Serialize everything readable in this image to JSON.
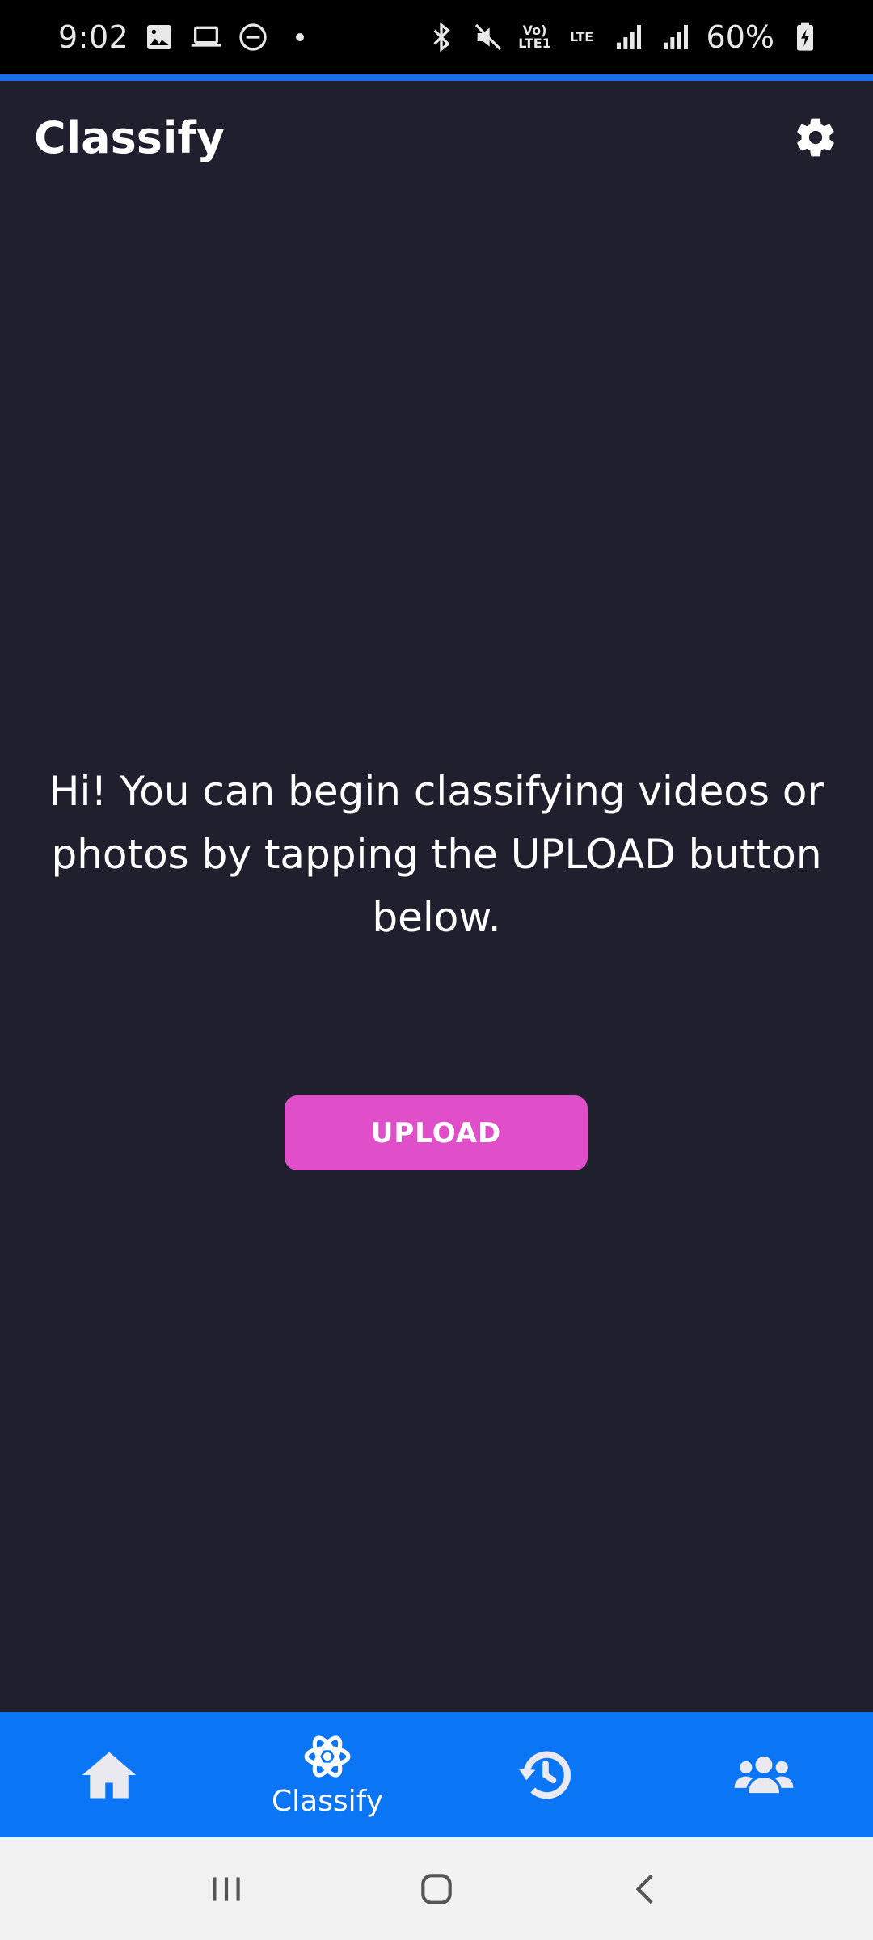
{
  "status_bar": {
    "time": "9:02",
    "battery": "60%",
    "volte_label": "Vo) LTE1",
    "lte_label": "LTE",
    "left_icons": [
      "gallery-icon",
      "laptop-icon",
      "do-not-disturb-icon",
      "notification-dot-icon"
    ],
    "right_icons": [
      "bluetooth-icon",
      "mute-icon",
      "volte-icon",
      "lte-icon",
      "signal-icon",
      "signal-icon",
      "battery-charging-icon"
    ]
  },
  "app_bar": {
    "title": "Classify",
    "settings_icon": "gear-icon"
  },
  "main": {
    "message": "Hi! You can begin classifying videos or photos by tapping the UPLOAD button below.",
    "upload_label": "UPLOAD"
  },
  "bottom_nav": {
    "items": [
      {
        "icon": "home-icon",
        "label": "",
        "active": false
      },
      {
        "icon": "atom-icon",
        "label": "Classify",
        "active": true
      },
      {
        "icon": "history-icon",
        "label": "",
        "active": false
      },
      {
        "icon": "users-icon",
        "label": "",
        "active": false
      }
    ]
  },
  "system_nav": {
    "buttons": [
      "recent-apps-icon",
      "home-circle-icon",
      "back-icon"
    ]
  },
  "colors": {
    "background": "#1f1f2e",
    "accent_blue": "#0a75f5",
    "upload_button": "#e04fc9",
    "progress_line": "#1a6fe6"
  }
}
